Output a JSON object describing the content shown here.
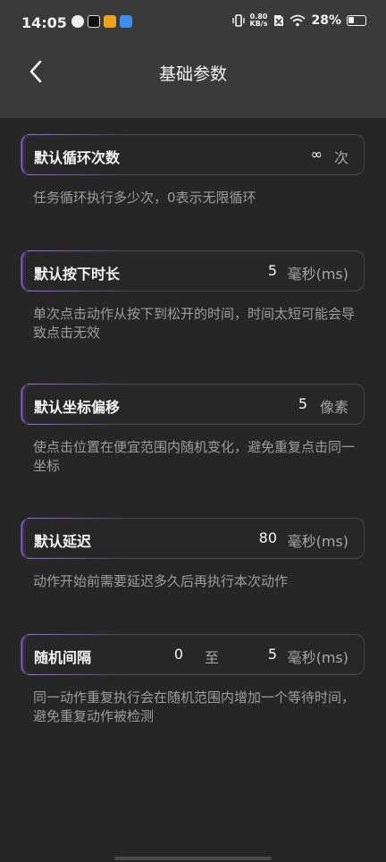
{
  "status_bar": {
    "time": "14:05",
    "net_speed_value": "0.80",
    "net_speed_unit": "KB/s",
    "battery": "28%"
  },
  "header": {
    "title": "基础参数"
  },
  "settings": {
    "loop_count": {
      "label": "默认循环次数",
      "value": "∞",
      "unit": "次",
      "description": "任务循环执行多少次，0表示无限循环"
    },
    "press_duration": {
      "label": "默认按下时长",
      "value": "5",
      "unit": "毫秒(ms)",
      "description": "单次点击动作从按下到松开的时间，时间太短可能会导致点击无效"
    },
    "coord_offset": {
      "label": "默认坐标偏移",
      "value": "5",
      "unit": "像素",
      "description": "使点击位置在便宜范围内随机变化，避免重复点击同一坐标"
    },
    "delay": {
      "label": "默认延迟",
      "value": "80",
      "unit": "毫秒(ms)",
      "description": "动作开始前需要延迟多久后再执行本次动作"
    },
    "random_interval": {
      "label": "随机间隔",
      "min": "0",
      "separator": "至",
      "max": "5",
      "unit": "毫秒(ms)",
      "description": "同一动作重复执行会在随机范围内增加一个等待时间，避免重复动作被检测"
    }
  },
  "colors": {
    "background": "#262626",
    "header_bg": "#3a3a3a",
    "accent": "#8a5cd6"
  }
}
